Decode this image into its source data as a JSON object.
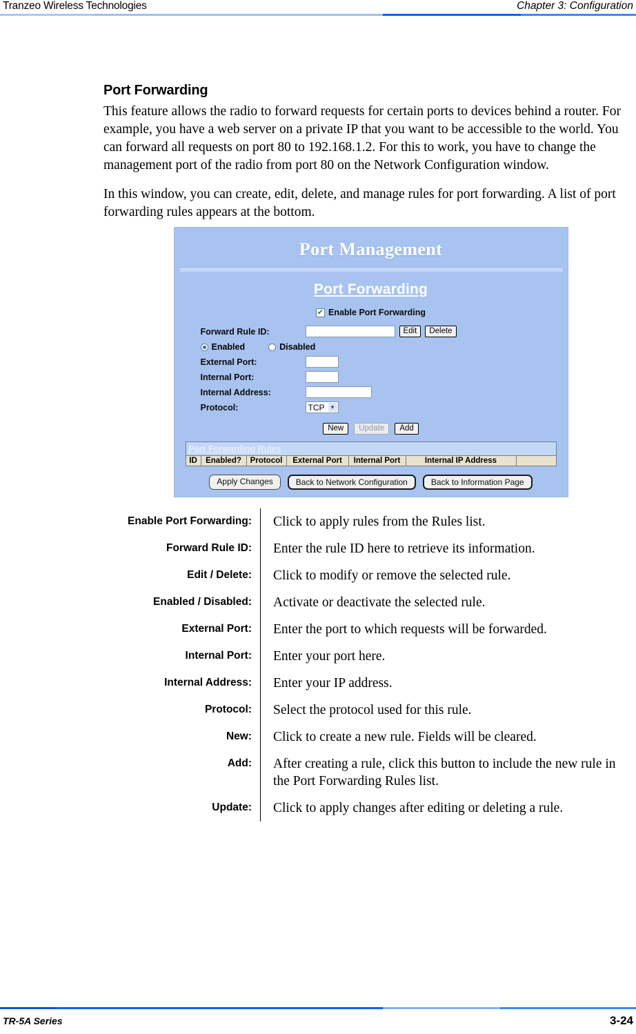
{
  "header": {
    "left": "Tranzeo Wireless Technologies",
    "right": "Chapter 3: Configuration"
  },
  "footer": {
    "left": "TR-5A Series",
    "page": "3-24"
  },
  "main": {
    "section_title": "Port Forwarding",
    "paragraph_1": "This feature allows the radio to forward requests for certain ports to devices behind a router. For example, you have a web server on a private IP that you want to be accessible to the world. You can forward all requests on port 80 to 192.168.1.2. For this to work, you have to change the management port of the radio from port 80 on the Network Configuration window.",
    "paragraph_2": "In this window, you can create, edit, delete, and manage rules for port forwarding. A list of port forwarding rules appears at the bottom."
  },
  "screenshot": {
    "window_title": "Port Management",
    "subtitle": "Port Forwarding",
    "enable_checkbox": {
      "label": "Enable Port Forwarding",
      "checked": true,
      "check_glyph": "✔"
    },
    "forward_rule_id": {
      "label": "Forward Rule ID:",
      "value": "",
      "edit_button": "Edit",
      "delete_button": "Delete"
    },
    "state_radios": {
      "enabled_label": "Enabled",
      "disabled_label": "Disabled",
      "selected": "Enabled"
    },
    "fields": [
      {
        "label": "External Port:",
        "value": ""
      },
      {
        "label": "Internal Port:",
        "value": ""
      },
      {
        "label": "Internal Address:",
        "value": ""
      }
    ],
    "protocol": {
      "label": "Protocol:",
      "value": "TCP",
      "options": [
        "TCP"
      ],
      "arrow_glyph": "▼"
    },
    "action_buttons": [
      {
        "label": "New",
        "disabled": false
      },
      {
        "label": "Update",
        "disabled": true
      },
      {
        "label": "Add",
        "disabled": false
      }
    ],
    "rules_table": {
      "title": "Port Forwarding Rules",
      "columns": [
        "ID",
        "Enabled?",
        "Protocol",
        "External Port",
        "Internal Port",
        "Internal IP Address",
        ""
      ],
      "rows": []
    },
    "bottom_buttons": [
      "Apply Changes",
      "Back to Network Configuration",
      "Back to Information Page"
    ],
    "colors": {
      "panel_background": "#a8c3f0",
      "title_text": "#ffffff",
      "table_header_background": "#e9e2cd"
    }
  },
  "definitions": [
    {
      "term": "Enable Port Forwarding:",
      "desc": "Click to apply rules from the Rules list."
    },
    {
      "term": "Forward Rule ID:",
      "desc": "Enter the rule ID here to retrieve its information."
    },
    {
      "term": "Edit / Delete:",
      "desc": "Click to modify or remove the selected rule."
    },
    {
      "term": "Enabled / Disabled:",
      "desc": "Activate or deactivate the selected rule."
    },
    {
      "term": "External Port:",
      "desc": "Enter the port to which requests will be forwarded."
    },
    {
      "term": "Internal Port:",
      "desc": "Enter your port here."
    },
    {
      "term": "Internal Address:",
      "desc": "Enter your IP address."
    },
    {
      "term": "Protocol:",
      "desc": "Select the protocol used for this rule."
    },
    {
      "term": "New:",
      "desc": "Click to create a new rule. Fields will be cleared."
    },
    {
      "term": "Add:",
      "desc": "After creating a rule, click this button to include the new rule in the Port Forwarding Rules list."
    },
    {
      "term": "Update:",
      "desc": "Click to apply changes after editing or deleting a rule."
    }
  ]
}
